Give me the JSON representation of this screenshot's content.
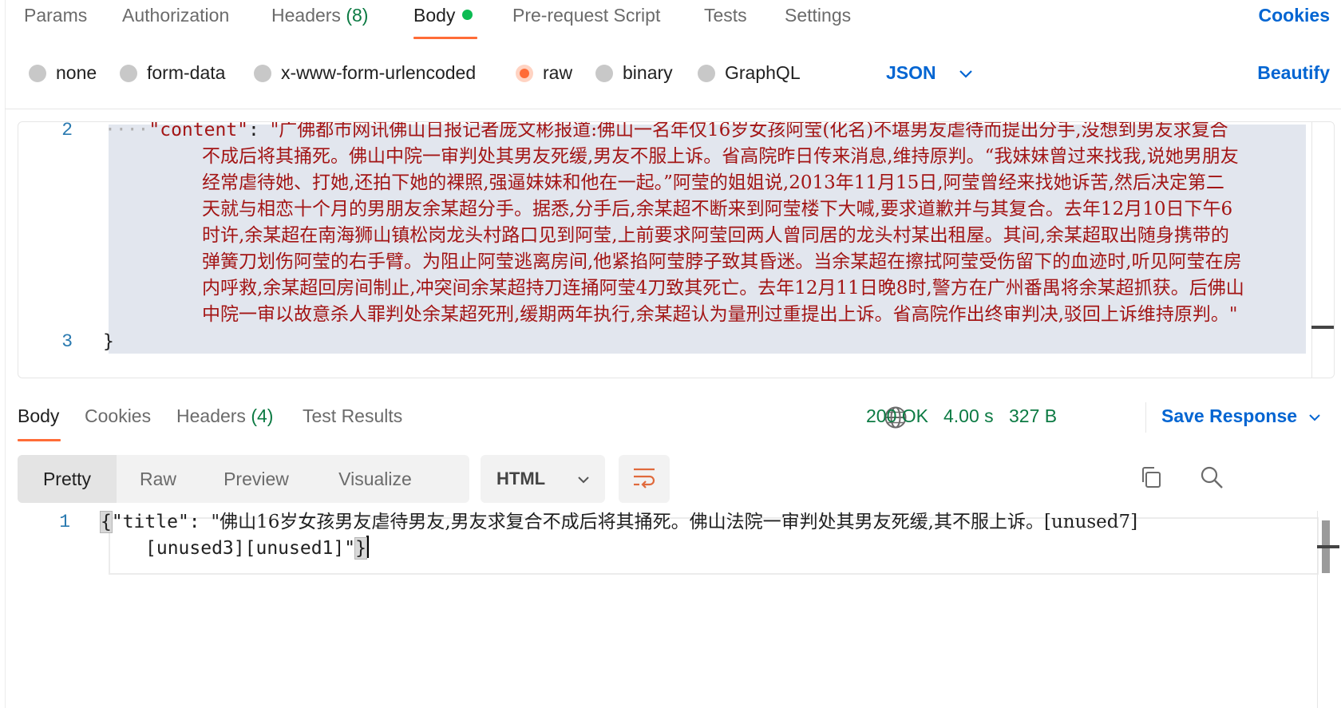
{
  "request_tabs": {
    "items": [
      {
        "label": "Params"
      },
      {
        "label": "Authorization"
      },
      {
        "label": "Headers",
        "count": "(8)"
      },
      {
        "label": "Body"
      },
      {
        "label": "Pre-request Script"
      },
      {
        "label": "Tests"
      },
      {
        "label": "Settings"
      }
    ],
    "active": "Body",
    "cookies_label": "Cookies"
  },
  "body_types": {
    "options": [
      "none",
      "form-data",
      "x-www-form-urlencoded",
      "raw",
      "binary",
      "GraphQL"
    ],
    "selected": "raw",
    "format": "JSON",
    "beautify_label": "Beautify"
  },
  "request_editor": {
    "line2_no": "2",
    "line3_no": "3",
    "indent_dots": "····",
    "key": "\"content\"",
    "colon": ": ",
    "content_lines": [
      "\"广佛都市网讯佛山日报记者庞文彬报道:佛山一名年仅16岁女孩阿莹(化名)不堪男友虐待而提出分手,没想到男友求复合",
      "不成后将其捅死。佛山中院一审判处其男友死缓,男友不服上诉。省高院昨日传来消息,维持原判。“我妹妹曾过来找我,说她男朋友",
      "经常虐待她、打她,还拍下她的裸照,强逼妹妹和他在一起。”阿莹的姐姐说,2013年11月15日,阿莹曾经来找她诉苦,然后决定第二",
      "天就与相恋十个月的男朋友余某超分手。据悉,分手后,余某超不断来到阿莹楼下大喊,要求道歉并与其复合。去年12月10日下午6",
      "时许,余某超在南海狮山镇松岗龙头村路口见到阿莹,上前要求阿莹回两人曾同居的龙头村某出租屋。其间,余某超取出随身携带的",
      "弹簧刀划伤阿莹的右手臂。为阻止阿莹逃离房间,他紧掐阿莹脖子致其昏迷。当余某超在擦拭阿莹受伤留下的血迹时,听见阿莹在房",
      "内呼救,余某超回房间制止,冲突间余某超持刀连捅阿莹4刀致其死亡。去年12月11日晚8时,警方在广州番禺将余某超抓获。后佛山",
      "中院一审以故意杀人罪判处余某超死刑,缓期两年执行,余某超认为量刑过重提出上诉。省高院作出终审判决,驳回上诉维持原判。\""
    ],
    "closing_brace": "}"
  },
  "response_tabs": {
    "items": [
      {
        "label": "Body"
      },
      {
        "label": "Cookies"
      },
      {
        "label": "Headers",
        "count": "(4)"
      },
      {
        "label": "Test Results"
      }
    ],
    "active": "Body",
    "status": "200 OK",
    "time": "4.00 s",
    "size": "327 B",
    "save_label": "Save Response"
  },
  "response_view": {
    "modes": [
      "Pretty",
      "Raw",
      "Preview",
      "Visualize"
    ],
    "active_mode": "Pretty",
    "format": "HTML"
  },
  "response_body": {
    "line_no": "1",
    "open_brace": "{",
    "key": "\"title\"",
    "colon": ": ",
    "value_line1": "\"佛山16岁女孩男友虐待男友,男友求复合不成后将其捅死。佛山法院一审判处其男友死缓,其不服上诉。[unused7]",
    "value_line2": "[unused3][unused1]\"",
    "close_brace": "}"
  },
  "colors": {
    "accent_orange": "#ff6c37",
    "link_blue": "#0265d2",
    "success_green": "#0c7a43",
    "string_red": "#a31515"
  },
  "icons": [
    "dot-indicator",
    "chevron-down-icon",
    "globe-icon",
    "wrap-lines-icon",
    "copy-icon",
    "search-icon"
  ]
}
